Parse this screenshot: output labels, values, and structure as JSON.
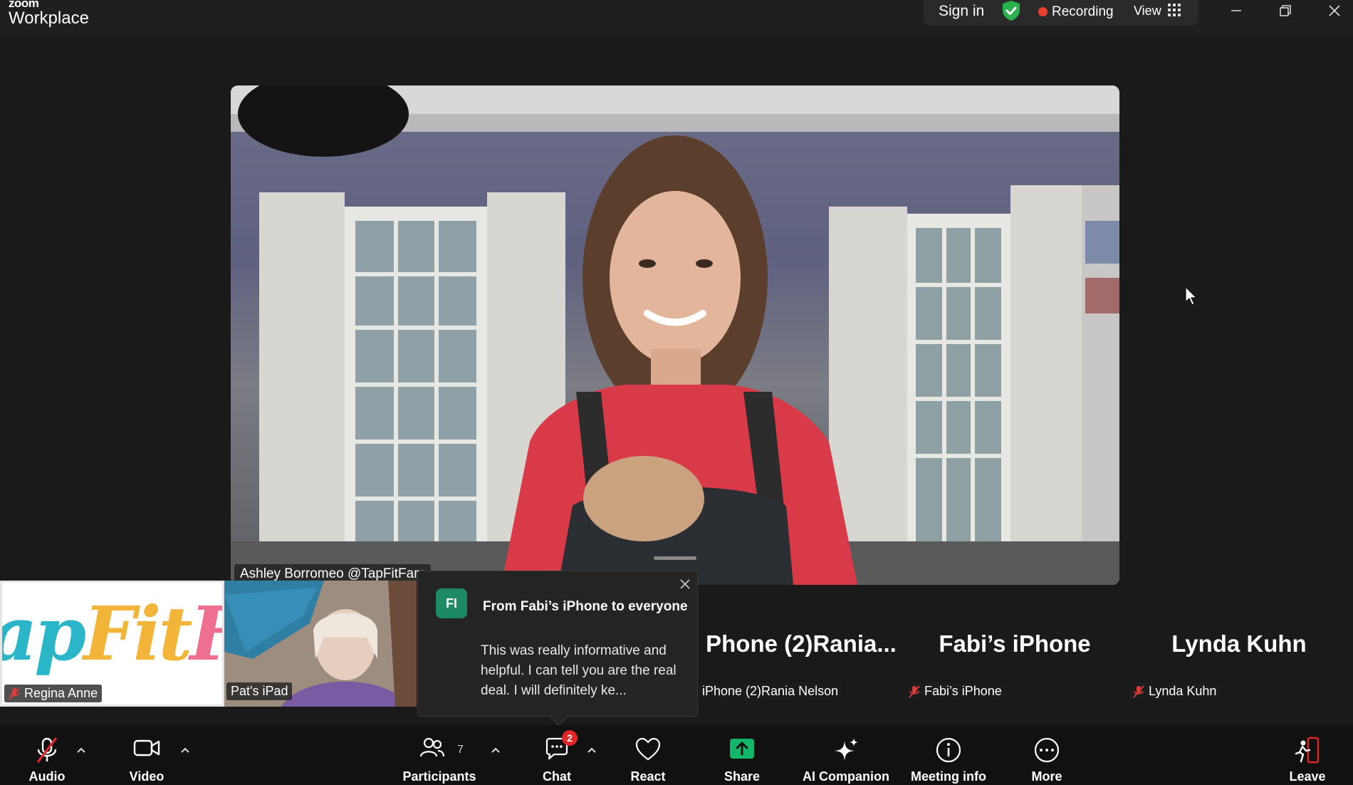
{
  "app": {
    "brand_top": "zoom",
    "brand_bottom": "Workplace"
  },
  "topbar": {
    "sign_in": "Sign in",
    "recording": "Recording",
    "view": "View"
  },
  "main_video": {
    "name": "Ashley Borromeo @TapFitFam"
  },
  "gallery": [
    {
      "logo_text": "apFitFa",
      "name": "Regina Anne",
      "muted": true
    },
    {
      "name": "Pat's iPad",
      "muted": false
    },
    {
      "big_name": "Phone (2)Rania...",
      "name": "iPhone (2)Rania Nelson",
      "muted": false
    },
    {
      "big_name": "Fabi’s iPhone",
      "name": "Fabi’s iPhone",
      "muted": true
    },
    {
      "big_name": "Lynda Kuhn",
      "name": "Lynda Kuhn",
      "muted": true
    }
  ],
  "chat_popup": {
    "avatar": "FI",
    "title": "From Fabi’s iPhone to everyone",
    "message": "This was really informative and helpful.  I can tell you are the real deal. I will definitely ke..."
  },
  "toolbar": {
    "audio": "Audio",
    "video": "Video",
    "participants": "Participants",
    "participants_count": "7",
    "chat": "Chat",
    "chat_badge": "2",
    "react": "React",
    "share": "Share",
    "ai_companion": "AI Companion",
    "meeting_info": "Meeting info",
    "more": "More",
    "leave": "Leave"
  },
  "colors": {
    "share_green": "#12b76a",
    "record_red": "#e8412d",
    "chat_avatar": "#1e8a63",
    "shield_green": "#2bb24c",
    "leave_red": "#e02828"
  }
}
